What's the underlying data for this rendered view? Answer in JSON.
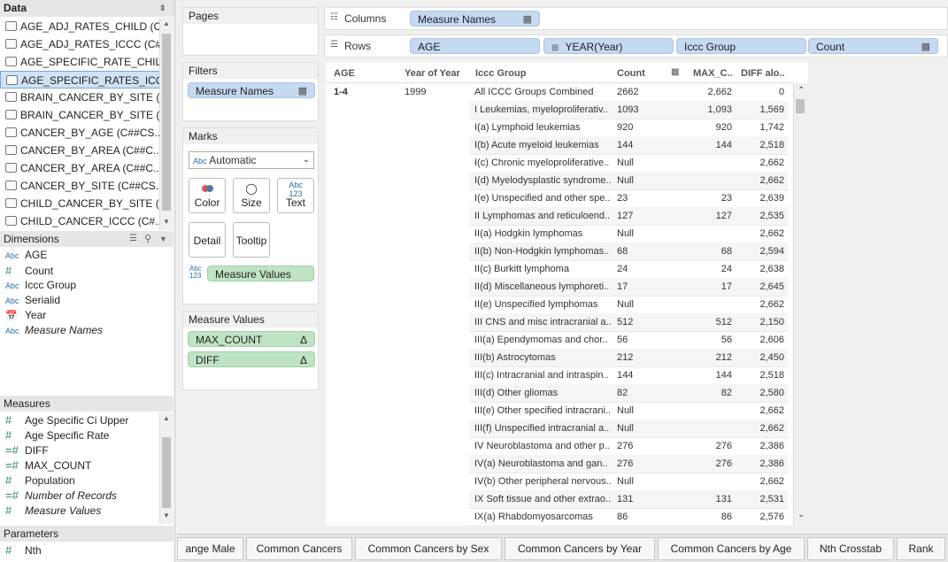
{
  "data_pane": {
    "title": "Data",
    "data_sources": [
      "AGE_ADJ_RATES_CHILD (C...",
      "AGE_ADJ_RATES_ICCC (C#...",
      "AGE_SPECIFIC_RATE_CHIL...",
      "AGE_SPECIFIC_RATES_ICC...",
      "BRAIN_CANCER_BY_SITE (...",
      "BRAIN_CANCER_BY_SITE (...",
      "CANCER_BY_AGE (C##CS...",
      "CANCER_BY_AREA (C##C...",
      "CANCER_BY_AREA (C##C...",
      "CANCER_BY_SITE (C##CS...",
      "CHILD_CANCER_BY_SITE (...",
      "CHILD_CANCER_ICCC (C#..."
    ],
    "selected_index": 3,
    "dimensions_title": "Dimensions",
    "dimensions": [
      {
        "type": "Abc",
        "name": "AGE",
        "italic": false
      },
      {
        "type": "#",
        "name": "Count",
        "italic": false
      },
      {
        "type": "Abc",
        "name": "Iccc Group",
        "italic": false
      },
      {
        "type": "Abc",
        "name": "Serialid",
        "italic": false
      },
      {
        "type": "date",
        "name": "Year",
        "italic": false
      },
      {
        "type": "Abc",
        "name": "Measure Names",
        "italic": true
      }
    ],
    "measures_title": "Measures",
    "measures": [
      {
        "type": "#",
        "name": "Age Specific Ci Upper",
        "italic": false
      },
      {
        "type": "#",
        "name": "Age Specific Rate",
        "italic": false
      },
      {
        "type": "=#",
        "name": "DIFF",
        "italic": false
      },
      {
        "type": "=#",
        "name": "MAX_COUNT",
        "italic": false
      },
      {
        "type": "#",
        "name": "Population",
        "italic": false
      },
      {
        "type": "=#",
        "name": "Number of Records",
        "italic": true
      },
      {
        "type": "#",
        "name": "Measure Values",
        "italic": true
      }
    ],
    "parameters_title": "Parameters",
    "parameters": [
      {
        "type": "#",
        "name": "Nth"
      }
    ]
  },
  "shelves": {
    "pages_title": "Pages",
    "filters_title": "Filters",
    "filters": [
      "Measure Names"
    ],
    "marks_title": "Marks",
    "mark_type": "Automatic",
    "mark_type_prefix": "Abc",
    "mark_buttons": [
      "Color",
      "Size",
      "Text",
      "Detail",
      "Tooltip"
    ],
    "marks_pill": "Measure Values",
    "measure_values_title": "Measure Values",
    "measure_values": [
      "MAX_COUNT",
      "DIFF"
    ],
    "columns_label": "Columns",
    "columns": [
      "Measure Names"
    ],
    "rows_label": "Rows",
    "rows": [
      "AGE",
      "YEAR(Year)",
      "Iccc Group",
      "Count"
    ]
  },
  "view": {
    "headers": [
      "AGE",
      "Year of Year",
      "Iccc Group",
      "Count",
      "MAX_C..",
      "DIFF alo.."
    ],
    "age": "1-4",
    "year": "1999",
    "rows": [
      {
        "group": "All ICCC Groups Combined",
        "count": "2662",
        "max": "2,662",
        "diff": "0"
      },
      {
        "group": "I Leukemias, myeloproliferativ..",
        "count": "1093",
        "max": "1,093",
        "diff": "1,569"
      },
      {
        "group": "I(a) Lymphoid leukemias",
        "count": "920",
        "max": "920",
        "diff": "1,742"
      },
      {
        "group": "I(b) Acute myeloid leukemias",
        "count": "144",
        "max": "144",
        "diff": "2,518"
      },
      {
        "group": "I(c) Chronic myeloproliferative..",
        "count": "Null",
        "max": "",
        "diff": "2,662"
      },
      {
        "group": "I(d) Myelodysplastic syndrome..",
        "count": "Null",
        "max": "",
        "diff": "2,662"
      },
      {
        "group": "I(e) Unspecified and other spe..",
        "count": "23",
        "max": "23",
        "diff": "2,639"
      },
      {
        "group": "II Lymphomas and reticuloend..",
        "count": "127",
        "max": "127",
        "diff": "2,535"
      },
      {
        "group": "II(a) Hodgkin lymphomas",
        "count": "Null",
        "max": "",
        "diff": "2,662"
      },
      {
        "group": "II(b) Non-Hodgkin lymphomas..",
        "count": "68",
        "max": "68",
        "diff": "2,594"
      },
      {
        "group": "II(c) Burkitt lymphoma",
        "count": "24",
        "max": "24",
        "diff": "2,638"
      },
      {
        "group": "II(d) Miscellaneous lymphoreti..",
        "count": "17",
        "max": "17",
        "diff": "2,645"
      },
      {
        "group": "II(e) Unspecified lymphomas",
        "count": "Null",
        "max": "",
        "diff": "2,662"
      },
      {
        "group": "III CNS and misc intracranial a..",
        "count": "512",
        "max": "512",
        "diff": "2,150"
      },
      {
        "group": "III(a) Ependymomas and chor..",
        "count": "56",
        "max": "56",
        "diff": "2,606"
      },
      {
        "group": "III(b) Astrocytomas",
        "count": "212",
        "max": "212",
        "diff": "2,450"
      },
      {
        "group": "III(c) Intracranial and intraspin..",
        "count": "144",
        "max": "144",
        "diff": "2,518"
      },
      {
        "group": "III(d) Other gliomas",
        "count": "82",
        "max": "82",
        "diff": "2,580"
      },
      {
        "group": "III(e) Other specified intracrani..",
        "count": "Null",
        "max": "",
        "diff": "2,662"
      },
      {
        "group": "III(f) Unspecified intracranial a..",
        "count": "Null",
        "max": "",
        "diff": "2,662"
      },
      {
        "group": "IV Neuroblastoma and other p..",
        "count": "276",
        "max": "276",
        "diff": "2,386"
      },
      {
        "group": "IV(a) Neuroblastoma and gan..",
        "count": "276",
        "max": "276",
        "diff": "2,386"
      },
      {
        "group": "IV(b) Other peripheral nervous..",
        "count": "Null",
        "max": "",
        "diff": "2,662"
      },
      {
        "group": "IX Soft tissue and other extrao..",
        "count": "131",
        "max": "131",
        "diff": "2,531"
      },
      {
        "group": "IX(a) Rhabdomyosarcomas",
        "count": "86",
        "max": "86",
        "diff": "2,576"
      }
    ]
  },
  "tabs": [
    "ange Male",
    "Common Cancers",
    "Common Cancers by Sex",
    "Common  Cancers by Year",
    "Common Cancers by Age",
    "Nth Crosstab",
    "Rank"
  ]
}
